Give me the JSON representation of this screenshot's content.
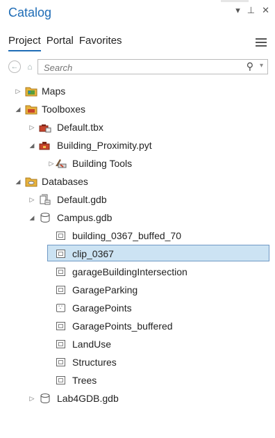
{
  "title": "Catalog",
  "window_controls": {
    "dropdown": "▾",
    "pin": "⊥",
    "close": "✕"
  },
  "tabs": [
    {
      "label": "Project",
      "active": true
    },
    {
      "label": "Portal",
      "active": false
    },
    {
      "label": "Favorites",
      "active": false
    }
  ],
  "search": {
    "placeholder": "Search",
    "value": ""
  },
  "tree": [
    {
      "label": "Maps",
      "level": 0,
      "expander": "collapsed",
      "icon": "maps-folder-icon"
    },
    {
      "label": "Toolboxes",
      "level": 0,
      "expander": "expanded",
      "icon": "toolboxes-folder-icon"
    },
    {
      "label": "Default.tbx",
      "level": 1,
      "expander": "collapsed",
      "icon": "toolbox-default-icon"
    },
    {
      "label": "Building_Proximity.pyt",
      "level": 1,
      "expander": "expanded",
      "icon": "python-toolbox-icon"
    },
    {
      "label": "Building Tools",
      "level": 2,
      "expander": "collapsed",
      "icon": "toolset-icon"
    },
    {
      "label": "Databases",
      "level": 0,
      "expander": "expanded",
      "icon": "databases-folder-icon"
    },
    {
      "label": "Default.gdb",
      "level": 1,
      "expander": "collapsed",
      "icon": "default-geodatabase-icon"
    },
    {
      "label": "Campus.gdb",
      "level": 1,
      "expander": "expanded",
      "icon": "geodatabase-icon"
    },
    {
      "label": "building_0367_buffed_70",
      "level": 2,
      "expander": "none",
      "icon": "polygon-feature-class-icon"
    },
    {
      "label": "clip_0367",
      "level": 2,
      "expander": "none",
      "icon": "polygon-feature-class-icon",
      "selected": true
    },
    {
      "label": "garageBuildingIntersection",
      "level": 2,
      "expander": "none",
      "icon": "polygon-feature-class-icon"
    },
    {
      "label": "GarageParking",
      "level": 2,
      "expander": "none",
      "icon": "polygon-feature-class-icon"
    },
    {
      "label": "GaragePoints",
      "level": 2,
      "expander": "none",
      "icon": "point-feature-class-icon"
    },
    {
      "label": "GaragePoints_buffered",
      "level": 2,
      "expander": "none",
      "icon": "polygon-feature-class-icon"
    },
    {
      "label": "LandUse",
      "level": 2,
      "expander": "none",
      "icon": "polygon-feature-class-icon"
    },
    {
      "label": "Structures",
      "level": 2,
      "expander": "none",
      "icon": "polygon-feature-class-icon"
    },
    {
      "label": "Trees",
      "level": 2,
      "expander": "none",
      "icon": "polygon-feature-class-icon"
    },
    {
      "label": "Lab4GDB.gdb",
      "level": 1,
      "expander": "collapsed",
      "icon": "geodatabase-icon"
    }
  ],
  "colors": {
    "accent": "#1e6cb6",
    "selection_fill": "#cce3f3",
    "selection_border": "#6e98c4",
    "folder": "#e8b23c"
  }
}
